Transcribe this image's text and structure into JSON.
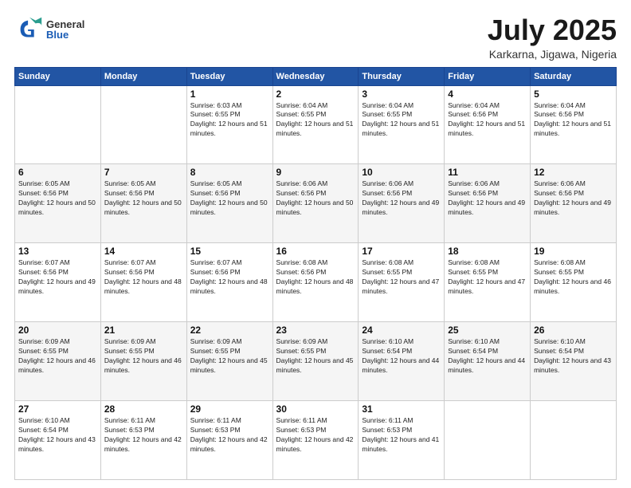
{
  "header": {
    "logo_general": "General",
    "logo_blue": "Blue",
    "title": "July 2025",
    "location": "Karkarna, Jigawa, Nigeria"
  },
  "weekdays": [
    "Sunday",
    "Monday",
    "Tuesday",
    "Wednesday",
    "Thursday",
    "Friday",
    "Saturday"
  ],
  "weeks": [
    [
      {
        "day": "",
        "sunrise": "",
        "sunset": "",
        "daylight": ""
      },
      {
        "day": "",
        "sunrise": "",
        "sunset": "",
        "daylight": ""
      },
      {
        "day": "1",
        "sunrise": "Sunrise: 6:03 AM",
        "sunset": "Sunset: 6:55 PM",
        "daylight": "Daylight: 12 hours and 51 minutes."
      },
      {
        "day": "2",
        "sunrise": "Sunrise: 6:04 AM",
        "sunset": "Sunset: 6:55 PM",
        "daylight": "Daylight: 12 hours and 51 minutes."
      },
      {
        "day": "3",
        "sunrise": "Sunrise: 6:04 AM",
        "sunset": "Sunset: 6:55 PM",
        "daylight": "Daylight: 12 hours and 51 minutes."
      },
      {
        "day": "4",
        "sunrise": "Sunrise: 6:04 AM",
        "sunset": "Sunset: 6:56 PM",
        "daylight": "Daylight: 12 hours and 51 minutes."
      },
      {
        "day": "5",
        "sunrise": "Sunrise: 6:04 AM",
        "sunset": "Sunset: 6:56 PM",
        "daylight": "Daylight: 12 hours and 51 minutes."
      }
    ],
    [
      {
        "day": "6",
        "sunrise": "Sunrise: 6:05 AM",
        "sunset": "Sunset: 6:56 PM",
        "daylight": "Daylight: 12 hours and 50 minutes."
      },
      {
        "day": "7",
        "sunrise": "Sunrise: 6:05 AM",
        "sunset": "Sunset: 6:56 PM",
        "daylight": "Daylight: 12 hours and 50 minutes."
      },
      {
        "day": "8",
        "sunrise": "Sunrise: 6:05 AM",
        "sunset": "Sunset: 6:56 PM",
        "daylight": "Daylight: 12 hours and 50 minutes."
      },
      {
        "day": "9",
        "sunrise": "Sunrise: 6:06 AM",
        "sunset": "Sunset: 6:56 PM",
        "daylight": "Daylight: 12 hours and 50 minutes."
      },
      {
        "day": "10",
        "sunrise": "Sunrise: 6:06 AM",
        "sunset": "Sunset: 6:56 PM",
        "daylight": "Daylight: 12 hours and 49 minutes."
      },
      {
        "day": "11",
        "sunrise": "Sunrise: 6:06 AM",
        "sunset": "Sunset: 6:56 PM",
        "daylight": "Daylight: 12 hours and 49 minutes."
      },
      {
        "day": "12",
        "sunrise": "Sunrise: 6:06 AM",
        "sunset": "Sunset: 6:56 PM",
        "daylight": "Daylight: 12 hours and 49 minutes."
      }
    ],
    [
      {
        "day": "13",
        "sunrise": "Sunrise: 6:07 AM",
        "sunset": "Sunset: 6:56 PM",
        "daylight": "Daylight: 12 hours and 49 minutes."
      },
      {
        "day": "14",
        "sunrise": "Sunrise: 6:07 AM",
        "sunset": "Sunset: 6:56 PM",
        "daylight": "Daylight: 12 hours and 48 minutes."
      },
      {
        "day": "15",
        "sunrise": "Sunrise: 6:07 AM",
        "sunset": "Sunset: 6:56 PM",
        "daylight": "Daylight: 12 hours and 48 minutes."
      },
      {
        "day": "16",
        "sunrise": "Sunrise: 6:08 AM",
        "sunset": "Sunset: 6:56 PM",
        "daylight": "Daylight: 12 hours and 48 minutes."
      },
      {
        "day": "17",
        "sunrise": "Sunrise: 6:08 AM",
        "sunset": "Sunset: 6:55 PM",
        "daylight": "Daylight: 12 hours and 47 minutes."
      },
      {
        "day": "18",
        "sunrise": "Sunrise: 6:08 AM",
        "sunset": "Sunset: 6:55 PM",
        "daylight": "Daylight: 12 hours and 47 minutes."
      },
      {
        "day": "19",
        "sunrise": "Sunrise: 6:08 AM",
        "sunset": "Sunset: 6:55 PM",
        "daylight": "Daylight: 12 hours and 46 minutes."
      }
    ],
    [
      {
        "day": "20",
        "sunrise": "Sunrise: 6:09 AM",
        "sunset": "Sunset: 6:55 PM",
        "daylight": "Daylight: 12 hours and 46 minutes."
      },
      {
        "day": "21",
        "sunrise": "Sunrise: 6:09 AM",
        "sunset": "Sunset: 6:55 PM",
        "daylight": "Daylight: 12 hours and 46 minutes."
      },
      {
        "day": "22",
        "sunrise": "Sunrise: 6:09 AM",
        "sunset": "Sunset: 6:55 PM",
        "daylight": "Daylight: 12 hours and 45 minutes."
      },
      {
        "day": "23",
        "sunrise": "Sunrise: 6:09 AM",
        "sunset": "Sunset: 6:55 PM",
        "daylight": "Daylight: 12 hours and 45 minutes."
      },
      {
        "day": "24",
        "sunrise": "Sunrise: 6:10 AM",
        "sunset": "Sunset: 6:54 PM",
        "daylight": "Daylight: 12 hours and 44 minutes."
      },
      {
        "day": "25",
        "sunrise": "Sunrise: 6:10 AM",
        "sunset": "Sunset: 6:54 PM",
        "daylight": "Daylight: 12 hours and 44 minutes."
      },
      {
        "day": "26",
        "sunrise": "Sunrise: 6:10 AM",
        "sunset": "Sunset: 6:54 PM",
        "daylight": "Daylight: 12 hours and 43 minutes."
      }
    ],
    [
      {
        "day": "27",
        "sunrise": "Sunrise: 6:10 AM",
        "sunset": "Sunset: 6:54 PM",
        "daylight": "Daylight: 12 hours and 43 minutes."
      },
      {
        "day": "28",
        "sunrise": "Sunrise: 6:11 AM",
        "sunset": "Sunset: 6:53 PM",
        "daylight": "Daylight: 12 hours and 42 minutes."
      },
      {
        "day": "29",
        "sunrise": "Sunrise: 6:11 AM",
        "sunset": "Sunset: 6:53 PM",
        "daylight": "Daylight: 12 hours and 42 minutes."
      },
      {
        "day": "30",
        "sunrise": "Sunrise: 6:11 AM",
        "sunset": "Sunset: 6:53 PM",
        "daylight": "Daylight: 12 hours and 42 minutes."
      },
      {
        "day": "31",
        "sunrise": "Sunrise: 6:11 AM",
        "sunset": "Sunset: 6:53 PM",
        "daylight": "Daylight: 12 hours and 41 minutes."
      },
      {
        "day": "",
        "sunrise": "",
        "sunset": "",
        "daylight": ""
      },
      {
        "day": "",
        "sunrise": "",
        "sunset": "",
        "daylight": ""
      }
    ]
  ]
}
